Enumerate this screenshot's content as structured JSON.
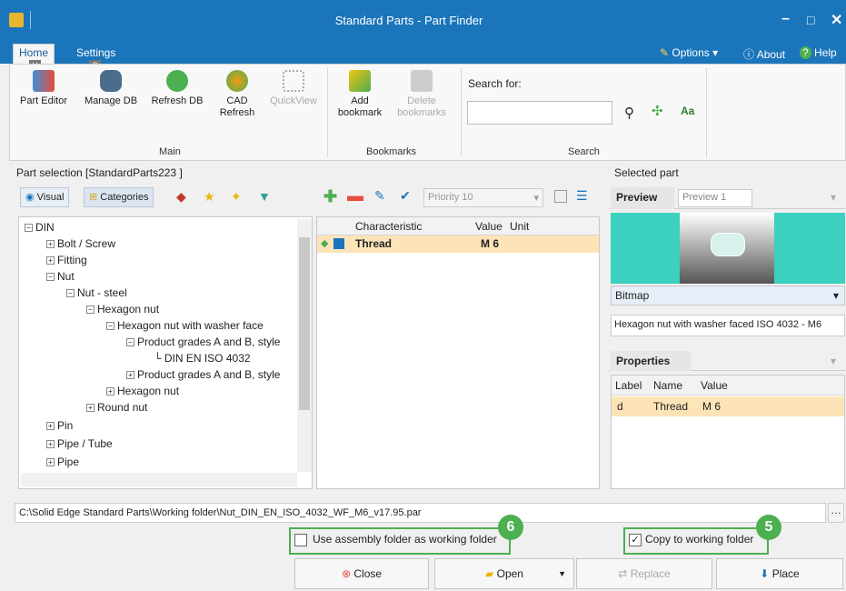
{
  "window": {
    "title": "Standard Parts - Part Finder"
  },
  "ribbon": {
    "tabs": [
      {
        "label": "Home",
        "keytip": "H"
      },
      {
        "label": "Settings",
        "keytip": "S"
      }
    ],
    "top_menu": {
      "options": "Options",
      "about": "About",
      "help": "Help"
    },
    "main": {
      "part_editor": "Part Editor",
      "manage_db": "Manage DB",
      "refresh_db": "Refresh DB",
      "cad_refresh_1": "CAD",
      "cad_refresh_2": "Refresh",
      "quickview": "QuickView",
      "label": "Main"
    },
    "bookmarks": {
      "add_1": "Add",
      "add_2": "bookmark",
      "delete_1": "Delete",
      "delete_2": "bookmarks",
      "label": "Bookmarks"
    },
    "search": {
      "label": "Search for:",
      "value": "",
      "group_label": "Search"
    }
  },
  "part_selection": {
    "title": "Part selection [StandardParts223 ]",
    "visual": "Visual",
    "categories": "Categories",
    "tree": [
      "DIN",
      "Bolt / Screw",
      "Fitting",
      "Nut",
      "Nut - steel",
      "Hexagon nut",
      "Hexagon nut with washer face",
      "Product grades A and B, style",
      "DIN EN ISO 4032",
      "Product grades A and B, style",
      "Hexagon nut",
      "Round nut",
      "Pin",
      "Pipe / Tube",
      "Pipe"
    ]
  },
  "characteristics": {
    "priority": "Priority 10",
    "columns": {
      "characteristic": "Characteristic",
      "value": "Value",
      "unit": "Unit"
    },
    "rows": [
      {
        "characteristic": "Thread",
        "value": "M 6",
        "unit": ""
      }
    ]
  },
  "selected_part": {
    "title": "Selected part",
    "preview_tab": "Preview",
    "preview_select": "Preview 1",
    "format": "Bitmap",
    "description": "Hexagon nut with washer faced ISO 4032 - M6",
    "properties_tab": "Properties",
    "prop_columns": {
      "label": "Label",
      "name": "Name",
      "value": "Value"
    },
    "prop_rows": [
      {
        "label": "d",
        "name": "Thread",
        "value": "M 6"
      }
    ]
  },
  "path": "C:\\Solid Edge Standard Parts\\Working folder\\Nut_DIN_EN_ISO_4032_WF_M6_v17.95.par",
  "options": {
    "use_assembly": {
      "label": "Use assembly folder as working folder",
      "checked": false,
      "callout": "6"
    },
    "copy_to_working": {
      "label": "Copy to working folder",
      "checked": true,
      "callout": "5"
    }
  },
  "buttons": {
    "close": "Close",
    "open": "Open",
    "replace": "Replace",
    "place": "Place"
  },
  "colors": {
    "accent": "#1b75bb",
    "highlight": "#fce4b8",
    "callout": "#4caf50",
    "preview_bg": "#3bd0c0"
  }
}
